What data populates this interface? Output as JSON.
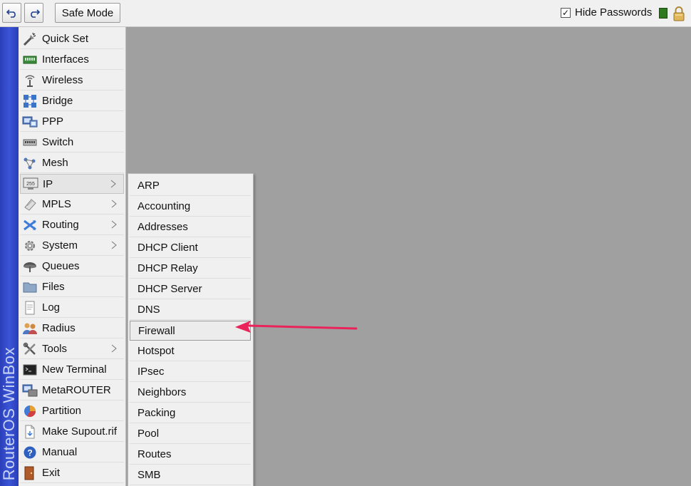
{
  "toolbar": {
    "undo_icon": "undo-icon",
    "redo_icon": "redo-icon",
    "safe_mode_label": "Safe Mode",
    "hide_passwords_label": "Hide Passwords",
    "hide_passwords_checked": "✓",
    "status_color": "#2d7a1f"
  },
  "sidebar": {
    "brand": "RouterOS WinBox"
  },
  "menu": {
    "items": [
      {
        "label": "Quick Set",
        "icon": "quick-set-icon"
      },
      {
        "label": "Interfaces",
        "icon": "interfaces-icon"
      },
      {
        "label": "Wireless",
        "icon": "wireless-icon"
      },
      {
        "label": "Bridge",
        "icon": "bridge-icon"
      },
      {
        "label": "PPP",
        "icon": "ppp-icon"
      },
      {
        "label": "Switch",
        "icon": "switch-icon"
      },
      {
        "label": "Mesh",
        "icon": "mesh-icon"
      },
      {
        "label": "IP",
        "icon": "ip-icon"
      },
      {
        "label": "MPLS",
        "icon": "mpls-icon"
      },
      {
        "label": "Routing",
        "icon": "routing-icon"
      },
      {
        "label": "System",
        "icon": "system-icon"
      },
      {
        "label": "Queues",
        "icon": "queues-icon"
      },
      {
        "label": "Files",
        "icon": "files-icon"
      },
      {
        "label": "Log",
        "icon": "log-icon"
      },
      {
        "label": "Radius",
        "icon": "radius-icon"
      },
      {
        "label": "Tools",
        "icon": "tools-icon"
      },
      {
        "label": "New Terminal",
        "icon": "terminal-icon"
      },
      {
        "label": "MetaROUTER",
        "icon": "metarouter-icon"
      },
      {
        "label": "Partition",
        "icon": "partition-icon"
      },
      {
        "label": "Make Supout.rif",
        "icon": "supout-icon"
      },
      {
        "label": "Manual",
        "icon": "manual-icon"
      },
      {
        "label": "Exit",
        "icon": "exit-icon"
      }
    ]
  },
  "submenu": {
    "parent": "IP",
    "items": [
      "ARP",
      "Accounting",
      "Addresses",
      "DHCP Client",
      "DHCP Relay",
      "DHCP Server",
      "DNS",
      "Firewall",
      "Hotspot",
      "IPsec",
      "Neighbors",
      "Packing",
      "Pool",
      "Routes",
      "SMB"
    ],
    "highlighted": "Firewall"
  },
  "annotation": {
    "arrow_color": "#e8245a"
  }
}
